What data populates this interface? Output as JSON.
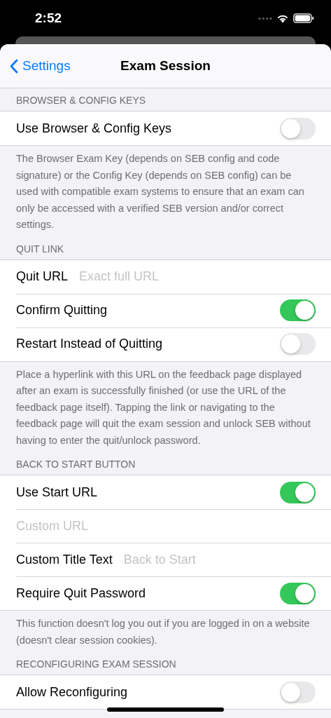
{
  "status_bar": {
    "time": "2:52"
  },
  "nav": {
    "back": "Settings",
    "title": "Exam Session"
  },
  "sections": [
    {
      "header": "BROWSER & CONFIG KEYS",
      "rows": [
        {
          "kind": "toggle",
          "label": "Use Browser & Config Keys",
          "on": false
        }
      ],
      "footer": "The Browser Exam Key (depends on SEB config and code signature) or the Config Key (depends on SEB config) can be used with compatible exam systems to ensure that an exam can only be accessed with a verified SEB version and/or correct settings."
    },
    {
      "header": "QUIT LINK",
      "rows": [
        {
          "kind": "field",
          "label": "Quit URL",
          "placeholder": "Exact full URL"
        },
        {
          "kind": "toggle",
          "label": "Confirm Quitting",
          "on": true
        },
        {
          "kind": "toggle",
          "label": "Restart Instead of Quitting",
          "on": false
        }
      ],
      "footer": "Place a hyperlink with this URL on the feedback page displayed after an exam is successfully finished (or use the URL of the feedback page itself). Tapping the link or navigating to the feedback page will quit the exam session and unlock SEB without having to enter the quit/unlock password."
    },
    {
      "header": "BACK TO START BUTTON",
      "rows": [
        {
          "kind": "toggle",
          "label": "Use Start URL",
          "on": true
        },
        {
          "kind": "field",
          "placeholder": "Custom URL"
        },
        {
          "kind": "field",
          "label": "Custom Title Text",
          "placeholder": "Back to Start"
        },
        {
          "kind": "toggle",
          "label": "Require Quit Password",
          "on": true
        }
      ],
      "footer": "This function doesn't log you out if you are logged in on a website (doesn't clear session cookies)."
    },
    {
      "header": "RECONFIGURING EXAM SESSION",
      "rows": [
        {
          "kind": "toggle",
          "label": "Allow Reconfiguring",
          "on": false
        }
      ]
    }
  ]
}
